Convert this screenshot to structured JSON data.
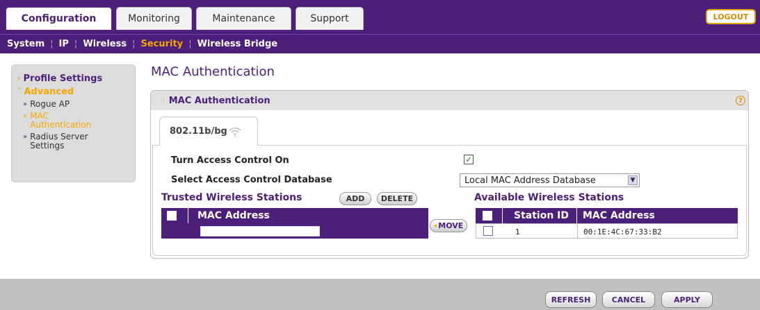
{
  "top_tabs": [
    {
      "label": "Configuration",
      "active": true
    },
    {
      "label": "Monitoring",
      "active": false
    },
    {
      "label": "Maintenance",
      "active": false
    },
    {
      "label": "Support",
      "active": false
    }
  ],
  "logout_label": "LOGOUT",
  "subnav": [
    {
      "label": "System",
      "active": false
    },
    {
      "label": "IP",
      "active": false
    },
    {
      "label": "Wireless",
      "active": false
    },
    {
      "label": "Security",
      "active": true
    },
    {
      "label": "Wireless Bridge",
      "active": false
    }
  ],
  "sidebar": {
    "profile_settings": "Profile Settings",
    "advanced": "Advanced",
    "rogue_ap": "Rogue AP",
    "mac_line1": "MAC",
    "mac_line2": "Authentication",
    "radius_line1": "Radius Server",
    "radius_line2": "Settings"
  },
  "page_title": "MAC Authentication",
  "panel": {
    "title": "MAC Authentication",
    "help_glyph": "?",
    "radio_tab": "802.11b/bg",
    "turn_access_label": "Turn Access Control On",
    "access_control_checked": true,
    "select_db_label": "Select Access Control Database",
    "select_db_value": "Local MAC Address Database",
    "trusted_title": "Trusted Wireless Stations",
    "add_label": "ADD",
    "delete_label": "DELETE",
    "move_label": "MOVE",
    "available_title": "Available Wireless Stations",
    "trusted_columns": [
      "MAC Address"
    ],
    "available_columns": [
      "Station ID",
      "MAC Address"
    ],
    "trusted_input_value": "",
    "available_rows": [
      {
        "station_id": "1",
        "mac": "00:1E:4C:67:33:B2",
        "checked": false
      }
    ]
  },
  "footer": {
    "refresh_label": "REFRESH",
    "cancel_label": "CANCEL",
    "apply_label": "APPLY"
  },
  "colors": {
    "brand_purple": "#4c1f7a",
    "accent_orange": "#f5a800"
  }
}
